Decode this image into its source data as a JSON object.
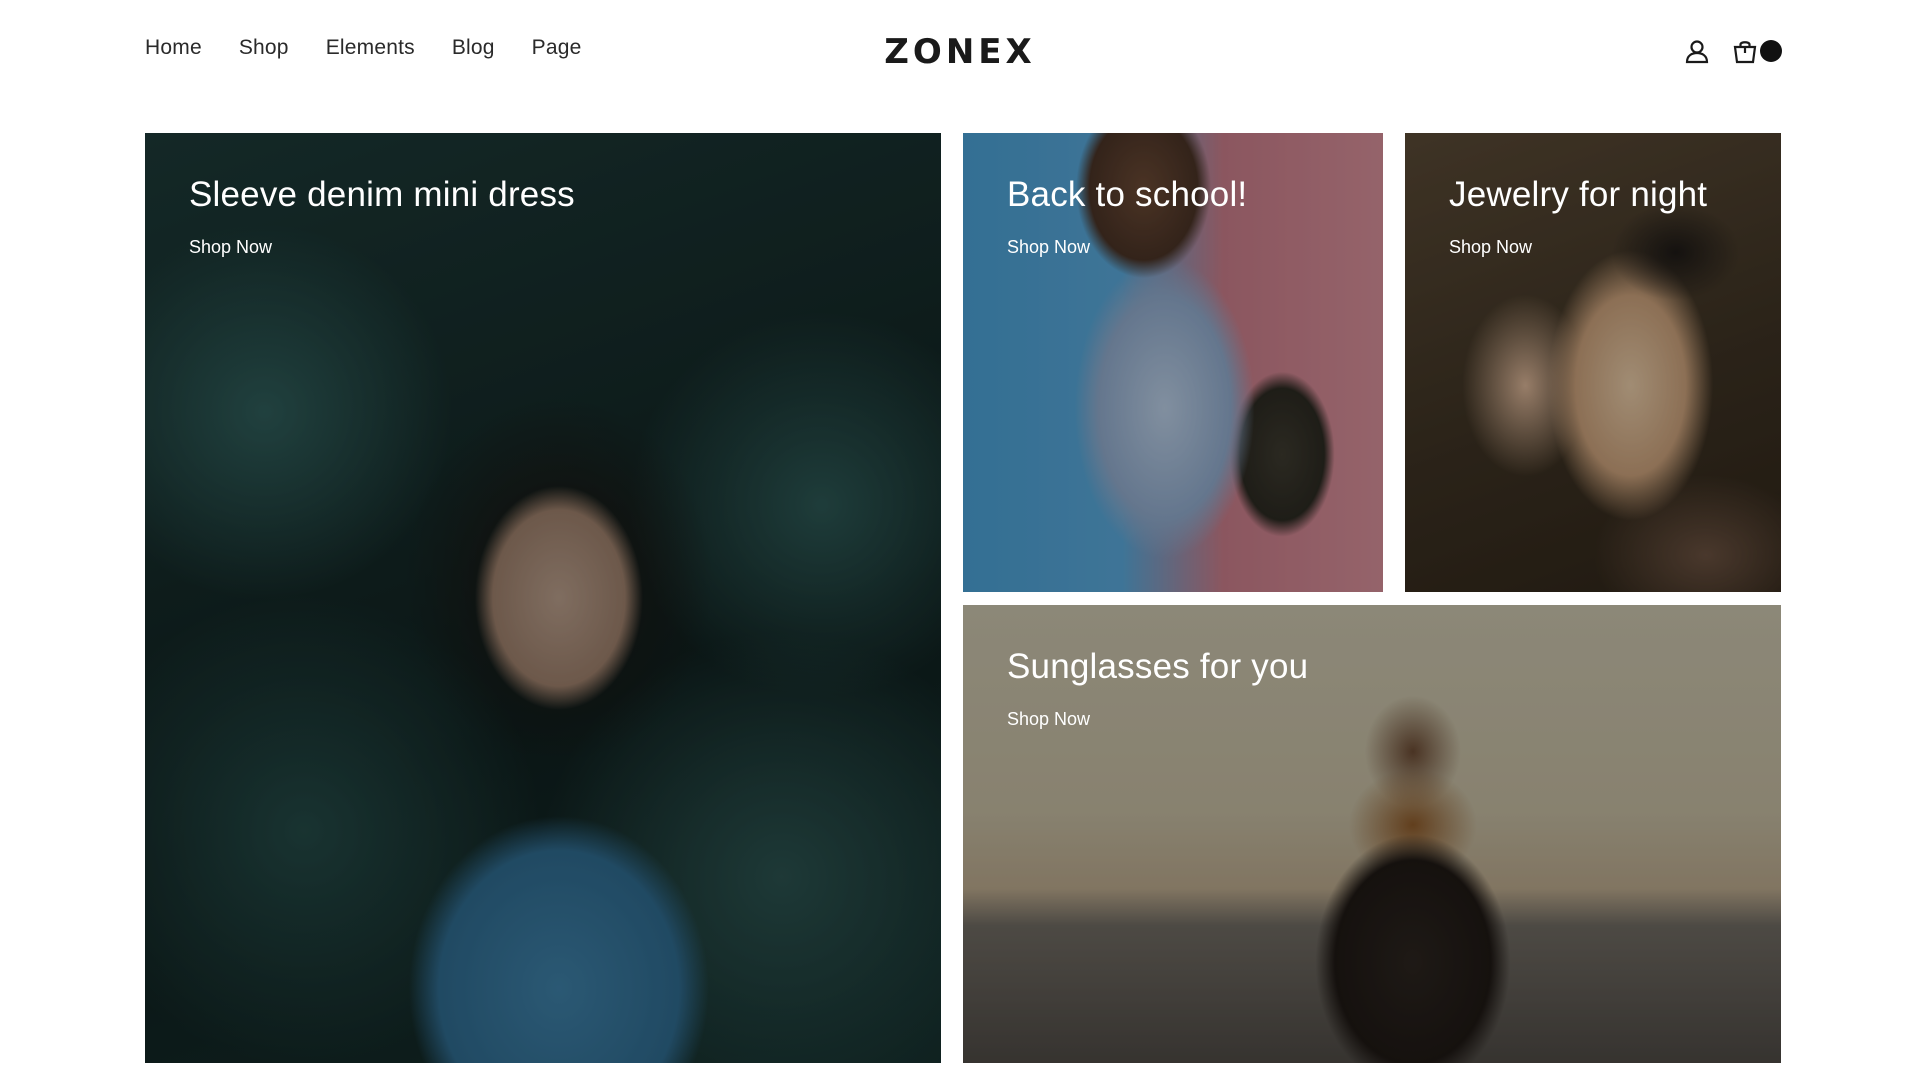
{
  "header": {
    "nav": [
      "Home",
      "Shop",
      "Elements",
      "Blog",
      "Page"
    ],
    "logo": "ZONEX",
    "icons": [
      "user-icon",
      "shopping-bag-icon"
    ]
  },
  "banners": [
    {
      "title": "Sleeve denim mini dress",
      "cta": "Shop Now"
    },
    {
      "title": "Back to school!",
      "cta": "Shop Now"
    },
    {
      "title": "Jewelry for night",
      "cta": "Shop Now"
    },
    {
      "title": "Sunglasses for you",
      "cta": "Shop Now"
    }
  ],
  "colors": {
    "text": "#2a2a2a",
    "overlay_text": "#ffffff",
    "cart_badge": "#111111"
  }
}
